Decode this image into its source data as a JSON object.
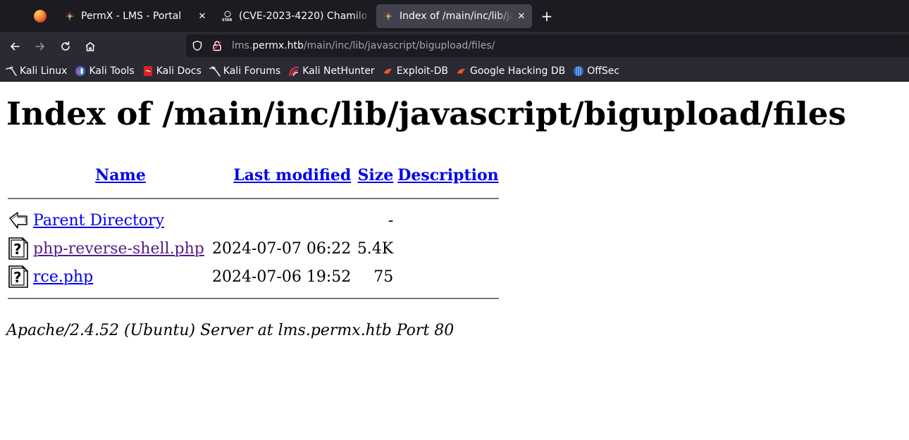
{
  "browser": {
    "tabs": [
      {
        "title": "PermX - LMS - Portal",
        "favicon": "chamilo-icon",
        "active": false
      },
      {
        "title": "(CVE-2023-4220) Chamilo",
        "favicon": "starr-icon",
        "active": false
      },
      {
        "title": "Index of /main/inc/lib/javascript/bigupload/files/",
        "favicon": "chamilo-icon",
        "active": true
      }
    ],
    "new_tab_label": "+",
    "url": {
      "prefix": "lms.",
      "host": "permx.htb",
      "path": "/main/inc/lib/javascript/bigupload/files/"
    },
    "bookmarks": [
      {
        "label": "Kali Linux",
        "icon": "kali-dragon-icon"
      },
      {
        "label": "Kali Tools",
        "icon": "kali-tools-icon"
      },
      {
        "label": "Kali Docs",
        "icon": "kali-docs-icon"
      },
      {
        "label": "Kali Forums",
        "icon": "kali-forums-icon"
      },
      {
        "label": "Kali NetHunter",
        "icon": "kali-nethunter-icon"
      },
      {
        "label": "Exploit-DB",
        "icon": "exploit-db-icon"
      },
      {
        "label": "Google Hacking DB",
        "icon": "ghdb-icon"
      },
      {
        "label": "OffSec",
        "icon": "offsec-icon"
      }
    ],
    "colors": {
      "tabbar": "#1c1b22",
      "toolbar": "#2b2a33",
      "active_tab": "#42414d",
      "text": "#fbfbfe"
    }
  },
  "page": {
    "title": "Index of /main/inc/lib/javascript/bigupload/files",
    "columns": {
      "name": "Name",
      "last_modified": "Last modified",
      "size": "Size",
      "description": "Description"
    },
    "rows": [
      {
        "icon": "back-folder-icon",
        "name": "Parent Directory",
        "modified": "",
        "size": "-",
        "description": "",
        "visited": false
      },
      {
        "icon": "unknown-file-icon",
        "name": "php-reverse-shell.php",
        "modified": "2024-07-07 06:22",
        "size": "5.4K",
        "description": "",
        "visited": true
      },
      {
        "icon": "unknown-file-icon",
        "name": "rce.php",
        "modified": "2024-07-06 19:52",
        "size": "75",
        "description": "",
        "visited": false
      }
    ],
    "server_signature": "Apache/2.4.52 (Ubuntu) Server at lms.permx.htb Port 80",
    "colors": {
      "link": "#0000ee",
      "visited_link": "#551a8b"
    }
  }
}
